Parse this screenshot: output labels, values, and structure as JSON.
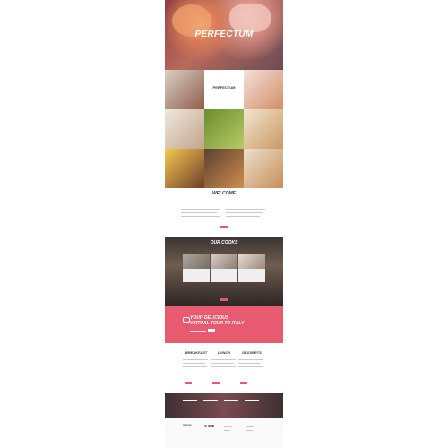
{
  "header": {
    "title": "PERFECTUM",
    "logo_label": "PERFECTUM"
  },
  "sections": {
    "welcome": {
      "title": "WELCOME",
      "button_label": ""
    },
    "cooks": {
      "title": "OUR COOKS",
      "items": [
        {
          "name": ""
        },
        {
          "name": ""
        },
        {
          "name": ""
        }
      ],
      "button_label": ""
    },
    "tour": {
      "line1": "YOUR DELICIOUS",
      "line2": "VIRTUAL TOUR TO ITALY"
    },
    "meals": [
      {
        "title": "BREAKFAST"
      },
      {
        "title": "LUNCH"
      },
      {
        "title": "DESSERTS"
      }
    ]
  },
  "footer": {
    "brand": "PERFECTUM"
  },
  "colors": {
    "accent": "#e75a70",
    "dark": "#3b3634"
  },
  "icons": {
    "plate": "plate-icon",
    "share": "share-icon"
  }
}
